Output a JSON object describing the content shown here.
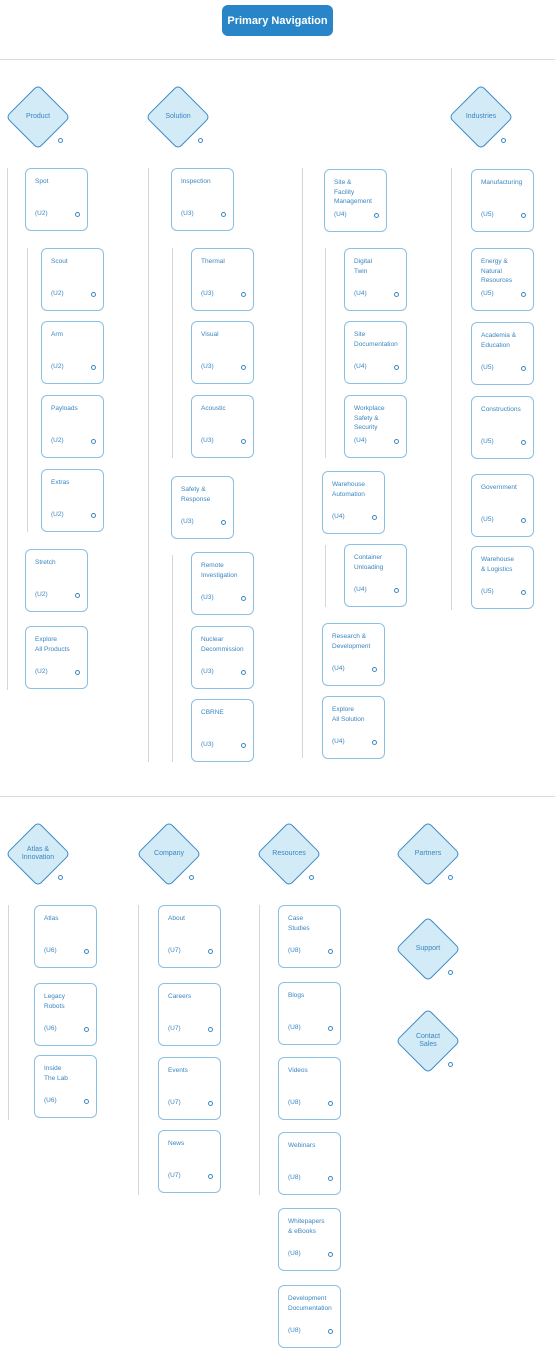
{
  "header": {
    "title": "Primary Navigation",
    "accent_color": "#2886c8"
  },
  "sections": [
    {
      "groups": [
        {
          "label": "Product",
          "items": [
            {
              "label": "Spot",
              "code": "(U2)",
              "children": [
                {
                  "label": "Scout",
                  "code": "(U2)"
                },
                {
                  "label": "Arm",
                  "code": "(U2)"
                },
                {
                  "label": "Payloads",
                  "code": "(U2)"
                },
                {
                  "label": "Extras",
                  "code": "(U2)"
                }
              ]
            },
            {
              "label": "Stretch",
              "code": "(U2)"
            },
            {
              "label": "Explore\nAll Products",
              "code": "(U2)"
            }
          ]
        },
        {
          "label": "Solution",
          "items": [
            {
              "label": "Inspection",
              "code": "(U3)",
              "children": [
                {
                  "label": "Thermal",
                  "code": "(U3)"
                },
                {
                  "label": "Visual",
                  "code": "(U3)"
                },
                {
                  "label": "Acoustic",
                  "code": "(U3)"
                }
              ]
            },
            {
              "label": "Safety &\nResponse",
              "code": "(U3)",
              "children": [
                {
                  "label": "Remote\nInvestigation",
                  "code": "(U3)"
                },
                {
                  "label": "Nuclear\nDecommission",
                  "code": "(U3)"
                },
                {
                  "label": "CBRNE",
                  "code": "(U3)"
                }
              ]
            }
          ]
        },
        {
          "label": "",
          "items": [
            {
              "label": "Site &\nFacility\nManagement",
              "code": "(U4)",
              "children": [
                {
                  "label": "Digital\nTwin",
                  "code": "(U4)"
                },
                {
                  "label": "Site\nDocumentation",
                  "code": "(U4)"
                },
                {
                  "label": "Workplace\nSafety &\nSecurity",
                  "code": "(U4)"
                }
              ]
            },
            {
              "label": "Warehouse\nAutomation",
              "code": "(U4)",
              "children": [
                {
                  "label": "Container\nUnloading",
                  "code": "(U4)"
                }
              ]
            },
            {
              "label": "Research &\nDevelopment",
              "code": "(U4)"
            },
            {
              "label": "Explore\nAll Solution",
              "code": "(U4)"
            }
          ]
        },
        {
          "label": "Industries",
          "items": [
            {
              "label": "Manufacturing",
              "code": "(U5)"
            },
            {
              "label": "Energy &\nNatural\nResources",
              "code": "(U5)"
            },
            {
              "label": "Academia &\nEducation",
              "code": "(U5)"
            },
            {
              "label": "Constructions",
              "code": "(U5)"
            },
            {
              "label": "Government",
              "code": "(U5)"
            },
            {
              "label": "Warehouse\n& Logistics",
              "code": "(U5)"
            }
          ]
        }
      ]
    },
    {
      "groups": [
        {
          "label": "Atlas &\nInnovation",
          "items": [
            {
              "label": "Atlas",
              "code": "(U6)"
            },
            {
              "label": "Legacy\nRobots",
              "code": "(U6)"
            },
            {
              "label": "Inside\nThe Lab",
              "code": "(U6)"
            }
          ]
        },
        {
          "label": "Company",
          "items": [
            {
              "label": "About",
              "code": "(U7)"
            },
            {
              "label": "Careers",
              "code": "(U7)"
            },
            {
              "label": "Events",
              "code": "(U7)"
            },
            {
              "label": "News",
              "code": "(U7)"
            }
          ]
        },
        {
          "label": "Resources",
          "items": [
            {
              "label": "Case\nStudies",
              "code": "(U8)"
            },
            {
              "label": "Blogs",
              "code": "(U8)"
            },
            {
              "label": "Videos",
              "code": "(U8)"
            },
            {
              "label": "Webinars",
              "code": "(U8)"
            },
            {
              "label": "Whitepapers\n& eBooks",
              "code": "(U8)"
            },
            {
              "label": "Development\nDocumentation",
              "code": "(U8)"
            }
          ]
        },
        {
          "label": "Partners",
          "items": []
        },
        {
          "label": "Support",
          "items": []
        },
        {
          "label": "Contact\nSales",
          "items": []
        }
      ]
    }
  ]
}
